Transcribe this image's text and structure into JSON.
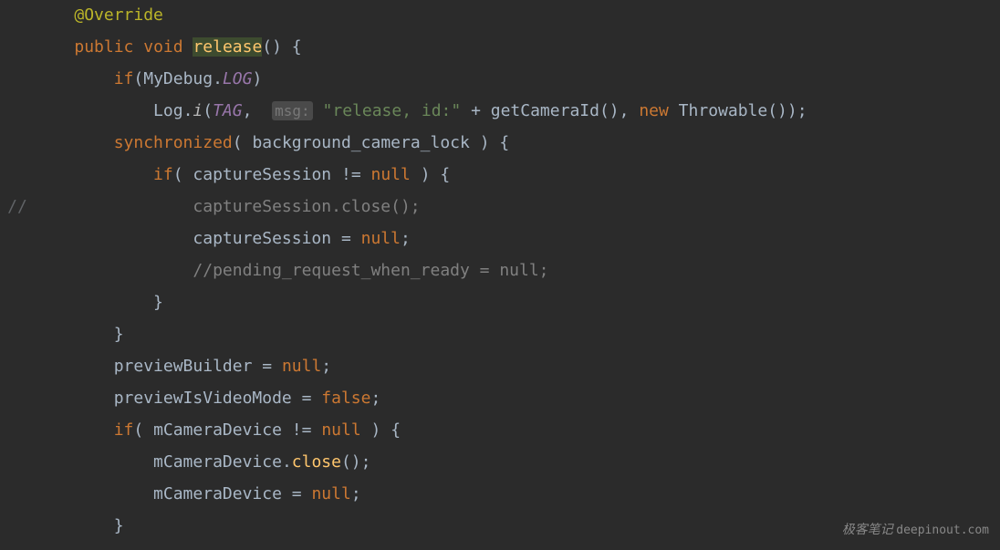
{
  "gutter": {
    "comment_marker": "//"
  },
  "code": {
    "line1": {
      "annotation": "@Override"
    },
    "line2": {
      "kw_public": "public",
      "kw_void": "void",
      "method": "release",
      "parens_open": "() {"
    },
    "line3": {
      "kw_if": "if",
      "paren_open": "(",
      "class_ref": "MyDebug",
      "dot": ".",
      "field": "LOG",
      "paren_close": ")"
    },
    "line4": {
      "log_class": "Log",
      "dot1": ".",
      "method_i": "i",
      "paren_open": "(",
      "tag": "TAG",
      "comma1": ", ",
      "hint": "msg:",
      "space": " ",
      "string": "\"release, id:\"",
      "plus": " + ",
      "getid": "getCameraId()",
      "comma2": ", ",
      "kw_new": "new",
      "throwable": " Throwable());"
    },
    "line5": {
      "kw_sync": "synchronized",
      "paren_open": "( ",
      "var": "background_camera_lock",
      "paren_close": " ) {"
    },
    "line6": {
      "kw_if": "if",
      "paren_open": "( ",
      "var": "captureSession",
      "neq": " != ",
      "kw_null": "null",
      "paren_close": " ) {"
    },
    "line7": {
      "text": "captureSession.close();"
    },
    "line8": {
      "var": "captureSession",
      "eq": " = ",
      "kw_null": "null",
      "semi": ";"
    },
    "line9": {
      "comment": "//pending_request_when_ready = null;"
    },
    "line10": {
      "brace": "}"
    },
    "line11": {
      "brace": "}"
    },
    "line12": {
      "var": "previewBuilder",
      "eq": " = ",
      "kw_null": "null",
      "semi": ";"
    },
    "line13": {
      "var": "previewIsVideoMode",
      "eq": " = ",
      "kw_false": "false",
      "semi": ";"
    },
    "line14": {
      "kw_if": "if",
      "paren_open": "( ",
      "var": "mCameraDevice",
      "neq": " != ",
      "kw_null": "null",
      "paren_close": " ) {"
    },
    "line15": {
      "var": "mCameraDevice",
      "dot": ".",
      "method": "close",
      "parens": "();"
    },
    "line16": {
      "var": "mCameraDevice",
      "eq": " = ",
      "kw_null": "null",
      "semi": ";"
    },
    "line17": {
      "brace": "}"
    }
  },
  "watermark": {
    "chinese": "极客笔记",
    "url": "deepinout.com"
  }
}
